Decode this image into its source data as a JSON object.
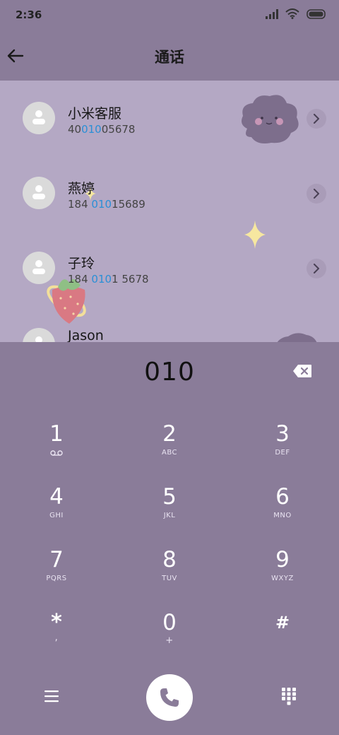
{
  "status_bar": {
    "time": "2:36"
  },
  "header": {
    "title": "通话"
  },
  "contacts": [
    {
      "name": "小米客服",
      "number_pre": "40",
      "number_match": "010",
      "number_post": "05678"
    },
    {
      "name": "燕婷",
      "number_pre": "184 ",
      "number_match": "010",
      "number_post": "15689"
    },
    {
      "name": "子玲",
      "number_pre": "184 ",
      "number_match": "010",
      "number_post": "1 5678"
    },
    {
      "name": "Jason",
      "number_pre": "",
      "number_match": "",
      "number_post": ""
    }
  ],
  "dialer": {
    "input": "010",
    "keys": [
      {
        "digit": "1",
        "letters": ""
      },
      {
        "digit": "2",
        "letters": "ABC"
      },
      {
        "digit": "3",
        "letters": "DEF"
      },
      {
        "digit": "4",
        "letters": "GHI"
      },
      {
        "digit": "5",
        "letters": "JKL"
      },
      {
        "digit": "6",
        "letters": "MNO"
      },
      {
        "digit": "7",
        "letters": "PQRS"
      },
      {
        "digit": "8",
        "letters": "TUV"
      },
      {
        "digit": "9",
        "letters": "WXYZ"
      },
      {
        "digit": "*",
        "letters": ","
      },
      {
        "digit": "0",
        "letters": "+"
      },
      {
        "digit": "#",
        "letters": ""
      }
    ]
  },
  "icons": {
    "back": "arrow-left-icon",
    "backspace": "backspace-icon",
    "voicemail": "voicemail-icon",
    "menu": "menu-icon",
    "call": "phone-icon",
    "keypad": "dialpad-icon"
  },
  "colors": {
    "background": "#8a7c99",
    "list_background": "#b4a8c4",
    "match_highlight": "#2a8fd6"
  }
}
